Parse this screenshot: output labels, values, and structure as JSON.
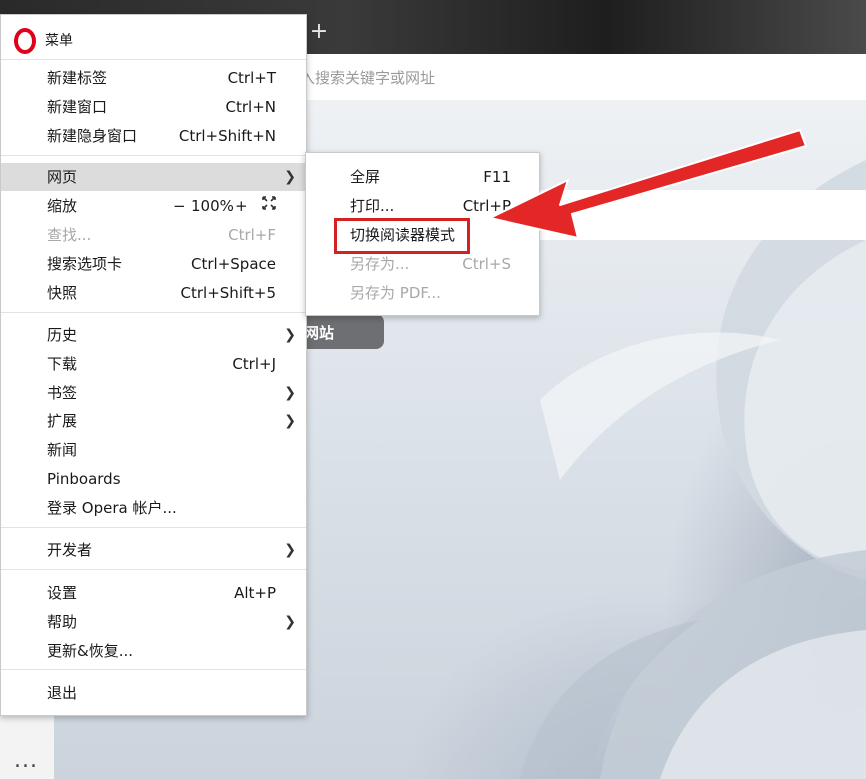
{
  "browser": {
    "new_tab_symbol": "+",
    "address_placeholder": "入搜索关键字或网址",
    "speed_dial_label": "网站",
    "more_symbol": "..."
  },
  "menu": {
    "title": "菜单",
    "items": [
      {
        "label": "新建标签",
        "shortcut": "Ctrl+T"
      },
      {
        "label": "新建窗口",
        "shortcut": "Ctrl+N"
      },
      {
        "label": "新建隐身窗口",
        "shortcut": "Ctrl+Shift+N"
      },
      {
        "label": "网页",
        "shortcut": ""
      },
      {
        "label": "缩放",
        "shortcut": ""
      },
      {
        "label": "查找...",
        "shortcut": "Ctrl+F"
      },
      {
        "label": "搜索选项卡",
        "shortcut": "Ctrl+Space"
      },
      {
        "label": "快照",
        "shortcut": "Ctrl+Shift+5"
      },
      {
        "label": "历史",
        "shortcut": ""
      },
      {
        "label": "下载",
        "shortcut": "Ctrl+J"
      },
      {
        "label": "书签",
        "shortcut": ""
      },
      {
        "label": "扩展",
        "shortcut": ""
      },
      {
        "label": "新闻",
        "shortcut": ""
      },
      {
        "label": "Pinboards",
        "shortcut": ""
      },
      {
        "label": "登录 Opera 帐户...",
        "shortcut": ""
      },
      {
        "label": "开发者",
        "shortcut": ""
      },
      {
        "label": "设置",
        "shortcut": "Alt+P"
      },
      {
        "label": "帮助",
        "shortcut": ""
      },
      {
        "label": "更新&恢复...",
        "shortcut": ""
      },
      {
        "label": "退出",
        "shortcut": ""
      }
    ],
    "zoom": {
      "minus": "−",
      "value": "100%",
      "plus": "+"
    }
  },
  "submenu": {
    "items": [
      {
        "label": "全屏",
        "shortcut": "F11"
      },
      {
        "label": "打印...",
        "shortcut": "Ctrl+P"
      },
      {
        "label": "切换阅读器模式",
        "shortcut": ""
      },
      {
        "label": "另存为...",
        "shortcut": "Ctrl+S"
      },
      {
        "label": "另存为 PDF...",
        "shortcut": ""
      }
    ]
  },
  "icons": {
    "arrow_right": "chevron-right-icon",
    "fullscreen": "fullscreen-icon",
    "logo": "opera-logo-icon"
  },
  "colors": {
    "highlight": "#d32020",
    "opera_red": "#e0001b",
    "active_row": "#dcdcdc"
  }
}
